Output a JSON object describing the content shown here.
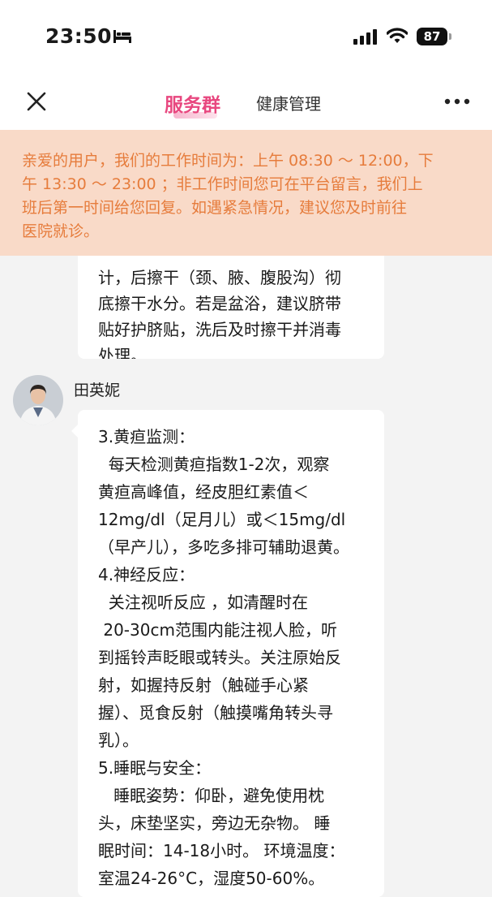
{
  "status_bar": {
    "time": "23:50",
    "battery": "87"
  },
  "header": {
    "active_tab": "服务群",
    "other_tab": "健康管理"
  },
  "notice": {
    "lines": [
      "亲爱的用户，我们的工作时间为：上午 08:30 ～ 12:00，下",
      "午 13:30 ～ 23:00 ；非工作时间您可在平台留言，我们上",
      "班后第一时间给您回复。如遇紧急情况，建议您及时前往",
      "医院就诊。"
    ]
  },
  "chat": {
    "previous_message": {
      "lines": [
        "计，后擦干（颈、腋、腹股沟）彻",
        "底擦干水分。若是盆浴，建议脐带",
        "贴好护脐贴，洗后及时擦干并消毒",
        "处理。"
      ]
    },
    "message": {
      "sender": "田英妮",
      "lines": [
        "3.黄疸监测：",
        "  每天检测黄疸指数1-2次，观察",
        "黄疸高峰值，经皮胆红素值＜",
        "12mg/dl（足月儿）或＜15mg/dl",
        "（早产儿），多吃多排可辅助退黄。",
        "4.神经反应：",
        "  关注视听反应 ，如清醒时在",
        " 20-30cm范围内能注视人脸，听",
        "到摇铃声眨眼或转头。关注原始反",
        "射，如握持反射（触碰手心紧",
        "握）、觅食反射（触摸嘴角转头寻",
        "乳）。",
        "5.睡眠与安全：",
        "   睡眠姿势：仰卧，避免使用枕",
        "头，床垫坚实，旁边无杂物。 睡",
        "眠时间：14-18小时。 环境温度：",
        "室温24-26°C，湿度50-60%。"
      ]
    }
  },
  "icons": {
    "bed": "bed-icon",
    "signal": "cellular-signal-icon",
    "wifi": "wifi-icon",
    "battery": "battery-icon",
    "close": "close-icon",
    "more": "more-dots-icon",
    "avatar": "doctor-avatar-icon"
  },
  "colors": {
    "accent_pink": "#e8477f",
    "notice_bg": "#f9dac8",
    "notice_text": "#e67c3c",
    "page_bg": "#f3f3f3"
  }
}
